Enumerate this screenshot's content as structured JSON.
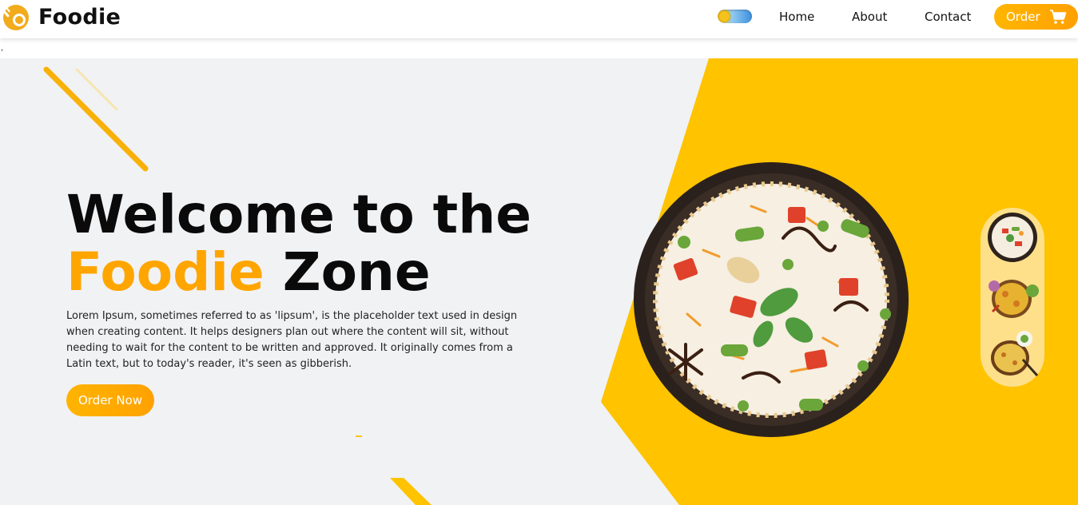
{
  "brand": {
    "name": "Foodie"
  },
  "nav": {
    "links": [
      "Home",
      "About",
      "Contact"
    ],
    "order_label": "Order"
  },
  "stray_text": ",",
  "hero": {
    "title_line1": "Welcome to the",
    "title_accent": "Foodie",
    "title_rest": "Zone",
    "body": "Lorem Ipsum, sometimes referred to as 'lipsum', is the placeholder text used in design when creating content. It helps designers plan out where the content will sit, without needing to wait for the content to be written and approved. It originally comes from a Latin text, but to today's reader, it's seen as gibberish.",
    "cta_label": "Order Now"
  },
  "colors": {
    "accent": "#ffa500",
    "yellow_panel": "#ffc300",
    "hero_bg": "#f1f2f4"
  },
  "icons": [
    "logo-icon",
    "theme-toggle",
    "cart-icon"
  ]
}
